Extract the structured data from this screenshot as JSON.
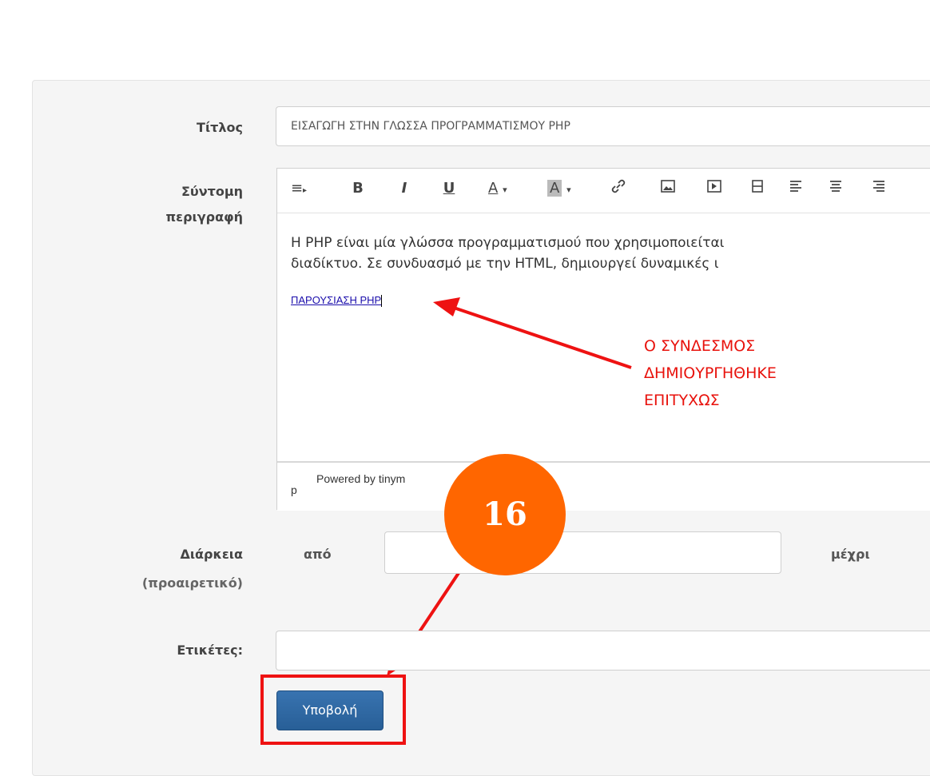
{
  "form": {
    "title_label": "Τίτλος",
    "title_value": "ΕΙΣΑΓΩΓΗ ΣΤΗΝ ΓΛΩΣΣΑ ΠΡΟΓΡΑΜΜΑΤΙΣΜΟΥ PHP",
    "description_label_line1": "Σύντομη",
    "description_label_line2": "περιγραφή",
    "duration_label": "Διάρκεια",
    "duration_optional": "(προαιρετικό)",
    "from_label": "από",
    "to_label": "μέχρι",
    "tags_label": "Ετικέτες:",
    "submit_label": "Υποβολή"
  },
  "editor": {
    "toolbar": {
      "format_icon": "≡",
      "bold": "B",
      "italic": "I",
      "underline": "U",
      "font_color": "A",
      "bg_color": "A"
    },
    "paragraph_line1": "Η PHP είναι μία γλώσσα προγραμματισμού που χρησιμοποιείται",
    "paragraph_line2": "διαδίκτυο. Σε συνδυασμό με την HTML, δημιουργεί δυναμικές ι",
    "link_text": "ΠΑΡΟΥΣΙΑΣΗ PHP",
    "status_path": "p",
    "status_powered": "Powered by tinym"
  },
  "annotation": {
    "text": "Ο ΣΥΝΔΕΣΜΟΣ\nΔΗΜΙΟΥΡΓΗΘΗΚΕ\nΕΠΙΤΥΧΩΣ",
    "step_number": "16",
    "color": "#e8120c",
    "badge_color": "#ff6600"
  }
}
